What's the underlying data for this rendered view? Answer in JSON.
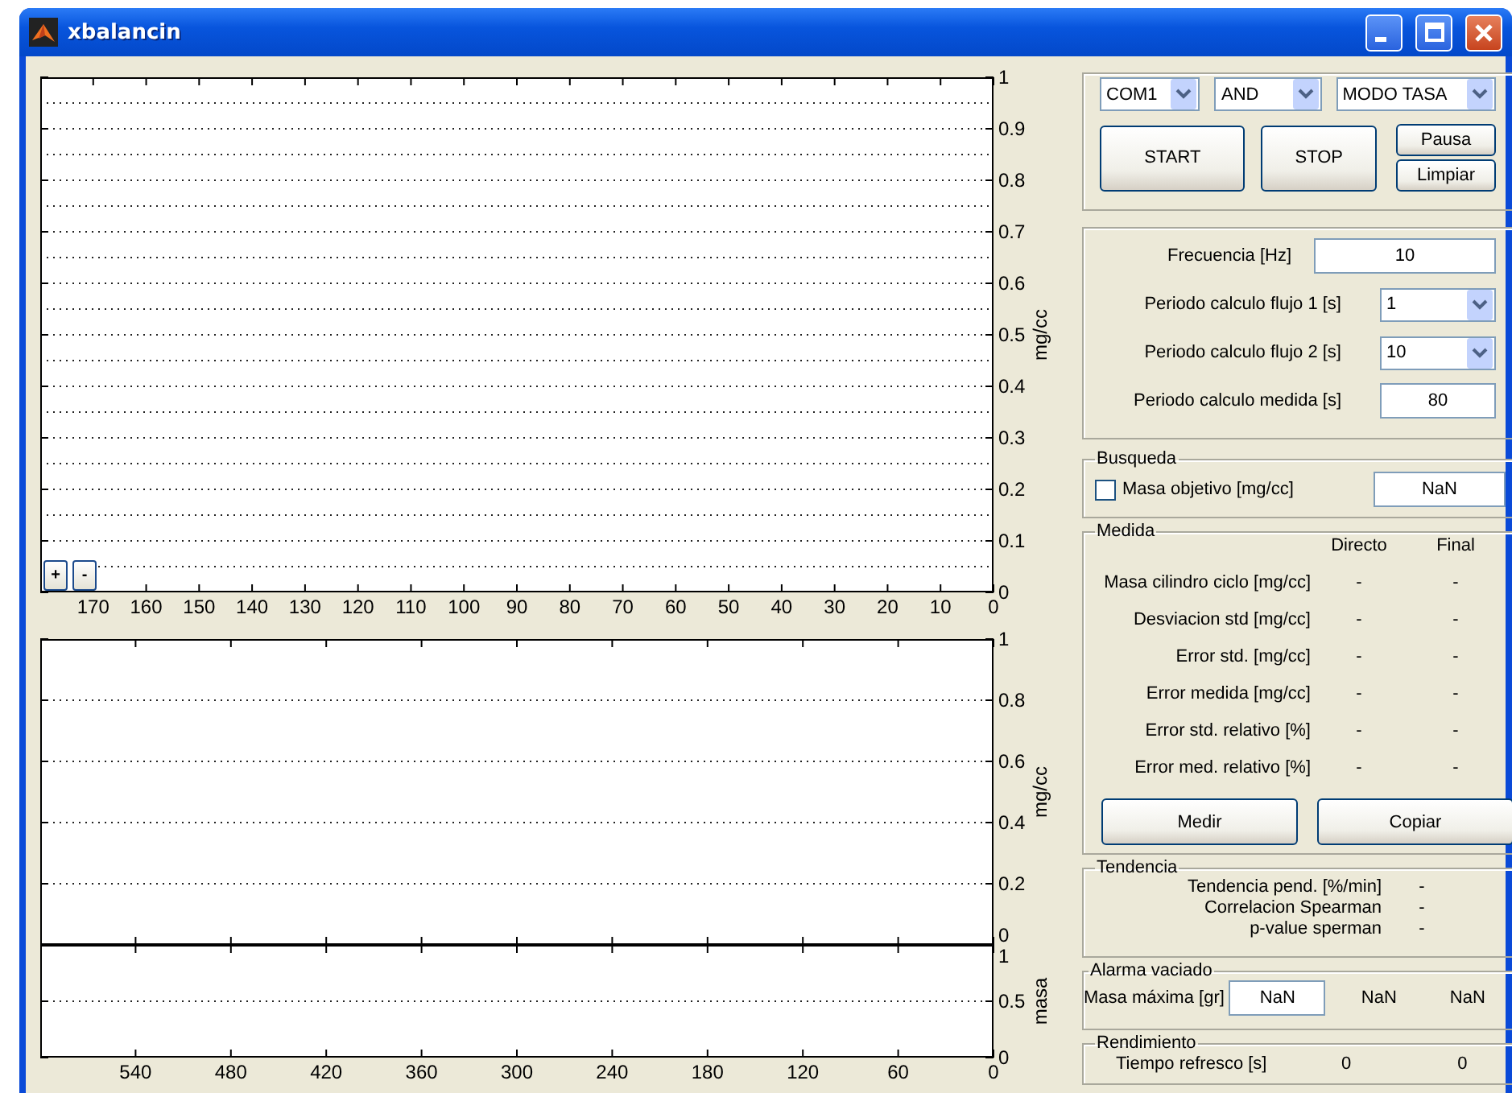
{
  "window": {
    "title": "xbalancin"
  },
  "plots": [
    {
      "minor_grid": true,
      "chart_data": {
        "type": "line",
        "grid": true,
        "ylabel": "mg/cc",
        "xlim": [
          180,
          0
        ],
        "ylim": [
          0,
          1
        ],
        "xticks": [
          170,
          160,
          150,
          140,
          130,
          120,
          110,
          100,
          90,
          80,
          70,
          60,
          50,
          40,
          30,
          20,
          10,
          0
        ],
        "yticks": [
          0,
          0.1,
          0.2,
          0.3,
          0.4,
          0.5,
          0.6,
          0.7,
          0.8,
          0.9,
          1
        ]
      }
    },
    {
      "minor_grid": false,
      "chart_data": {
        "type": "line",
        "grid": true,
        "ylabel": "mg/cc",
        "xlim": [
          600,
          0
        ],
        "ylim": [
          0,
          1
        ],
        "yticks": [
          0,
          0.2,
          0.4,
          0.6,
          0.8,
          1
        ]
      }
    },
    {
      "minor_grid": false,
      "chart_data": {
        "type": "line",
        "grid": true,
        "ylabel": "masa",
        "xlim": [
          600,
          0
        ],
        "ylim": [
          0,
          1
        ],
        "xticks": [
          540,
          480,
          420,
          360,
          300,
          240,
          180,
          120,
          60,
          0
        ],
        "yticks": [
          0,
          0.5,
          1
        ]
      }
    }
  ],
  "zoom_buttons": [
    "+",
    "-"
  ],
  "connection": {
    "dropdowns": [
      {
        "value": "COM1"
      },
      {
        "value": "AND"
      },
      {
        "value": "MODO TASA"
      }
    ],
    "buttons": [
      {
        "label": "START",
        "kind": "large"
      },
      {
        "label": "STOP",
        "kind": "large"
      },
      {
        "label": "Pausa",
        "kind": "small"
      },
      {
        "label": "Limpiar",
        "kind": "small"
      }
    ]
  },
  "settings": [
    {
      "label": "Frecuencia [Hz]",
      "kind": "wide-field",
      "value": "10"
    },
    {
      "label": "Periodo calculo flujo 1 [s]",
      "kind": "dropdown",
      "value": "1"
    },
    {
      "label": "Periodo calculo flujo 2 [s]",
      "kind": "dropdown",
      "value": "10"
    },
    {
      "label": "Periodo calculo medida [s]",
      "kind": "field",
      "value": "80"
    }
  ],
  "busqueda": {
    "title": "Busqueda",
    "checkbox": {
      "label": "Masa objetivo [mg/cc]",
      "checked": false
    },
    "value": "NaN"
  },
  "medida": {
    "title": "Medida",
    "columns": [
      "Directo",
      "Final"
    ],
    "rows": [
      {
        "label": "Masa cilindro ciclo [mg/cc]",
        "values": [
          "-",
          "-"
        ]
      },
      {
        "label": "Desviacion std [mg/cc]",
        "values": [
          "-",
          "-"
        ]
      },
      {
        "label": "Error std. [mg/cc]",
        "values": [
          "-",
          "-"
        ]
      },
      {
        "label": "Error medida [mg/cc]",
        "values": [
          "-",
          "-"
        ]
      },
      {
        "label": "Error std. relativo [%]",
        "values": [
          "-",
          "-"
        ]
      },
      {
        "label": "Error med. relativo [%]",
        "values": [
          "-",
          "-"
        ]
      }
    ],
    "buttons": [
      "Medir",
      "Copiar"
    ]
  },
  "tendencia": {
    "title": "Tendencia",
    "rows": [
      {
        "label": "Tendencia pend. [%/min]",
        "value": "-"
      },
      {
        "label": "Correlacion Spearman",
        "value": "-"
      },
      {
        "label": "p-value sperman",
        "value": "-"
      }
    ]
  },
  "alarma": {
    "title": "Alarma vaciado",
    "label": "Masa máxima [gr]",
    "value": "NaN",
    "values": [
      "NaN",
      "NaN"
    ]
  },
  "rendimiento": {
    "title": "Rendimiento",
    "label": "Tiempo refresco [s]",
    "values": [
      "0",
      "0"
    ]
  }
}
